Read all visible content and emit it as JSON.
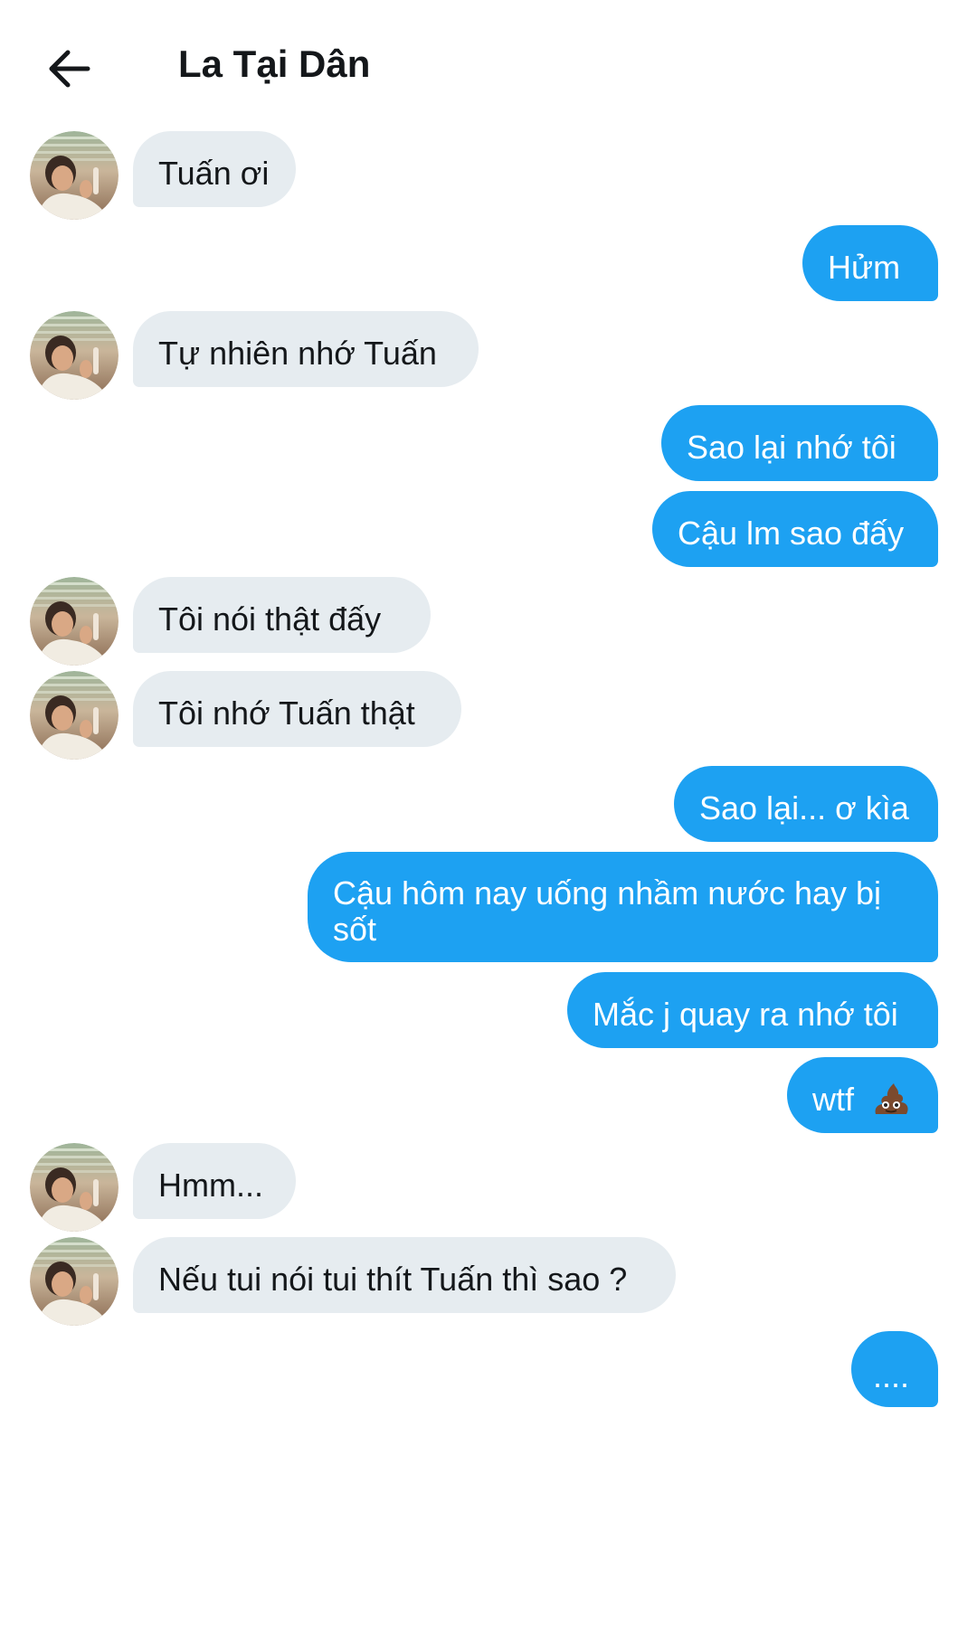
{
  "header": {
    "title": "La Tại Dân"
  },
  "messages": [
    {
      "text": "Tuấn ơi"
    },
    {
      "text": "Hửm"
    },
    {
      "text": "Tự nhiên nhớ Tuấn"
    },
    {
      "text": "Sao lại nhớ tôi"
    },
    {
      "text": "Cậu lm sao đấy"
    },
    {
      "text": "Tôi nói thật đấy"
    },
    {
      "text": "Tôi nhớ Tuấn thật"
    },
    {
      "text": "Sao lại... ơ kìa"
    },
    {
      "text": "Cậu hôm nay uống nhầm nước hay bị sốt"
    },
    {
      "text": "Mắc j quay ra nhớ tôi"
    },
    {
      "text": "wtf",
      "emoji": "pile-of-poo-emoji"
    },
    {
      "text": "Hmm..."
    },
    {
      "text": "Nếu tui nói tui thít Tuấn thì sao ?"
    },
    {
      "text": "...."
    }
  ],
  "colors": {
    "outgoing_bubble": "#1da1f2",
    "incoming_bubble": "#e6ecf0",
    "text_dark": "#14171a"
  },
  "icons": {
    "back": "arrow-left-icon",
    "avatar": "avatar-photo"
  }
}
